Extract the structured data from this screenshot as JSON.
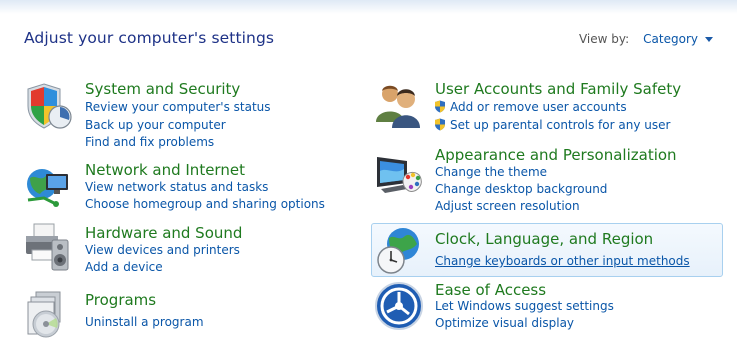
{
  "header": {
    "title": "Adjust your computer's settings",
    "view_by_label": "View by:",
    "view_by_value": "Category"
  },
  "left": [
    {
      "title": "System and Security",
      "icon": "shield-icon",
      "links": [
        "Review your computer's status",
        "Back up your computer",
        "Find and fix problems"
      ]
    },
    {
      "title": "Network and Internet",
      "icon": "globe-network-icon",
      "links": [
        "View network status and tasks",
        "Choose homegroup and sharing options"
      ]
    },
    {
      "title": "Hardware and Sound",
      "icon": "printer-speaker-icon",
      "links": [
        "View devices and printers",
        "Add a device"
      ]
    },
    {
      "title": "Programs",
      "icon": "programs-disc-icon",
      "links": [
        "Uninstall a program"
      ]
    }
  ],
  "right": [
    {
      "title": "User Accounts and Family Safety",
      "icon": "users-icon",
      "links": [
        "Add or remove user accounts",
        "Set up parental controls for any user"
      ]
    },
    {
      "title": "Appearance and Personalization",
      "icon": "monitor-palette-icon",
      "links": [
        "Change the theme",
        "Change desktop background",
        "Adjust screen resolution"
      ]
    },
    {
      "title": "Clock, Language, and Region",
      "icon": "clock-globe-icon",
      "links": [
        "Change keyboards or other input methods"
      ]
    },
    {
      "title": "Ease of Access",
      "icon": "ease-of-access-icon",
      "links": [
        "Let Windows suggest settings",
        "Optimize visual display"
      ]
    }
  ],
  "colors": {
    "title_blue": "#1e3287",
    "category_green": "#1f7a1f",
    "link_blue": "#0a56a8"
  }
}
